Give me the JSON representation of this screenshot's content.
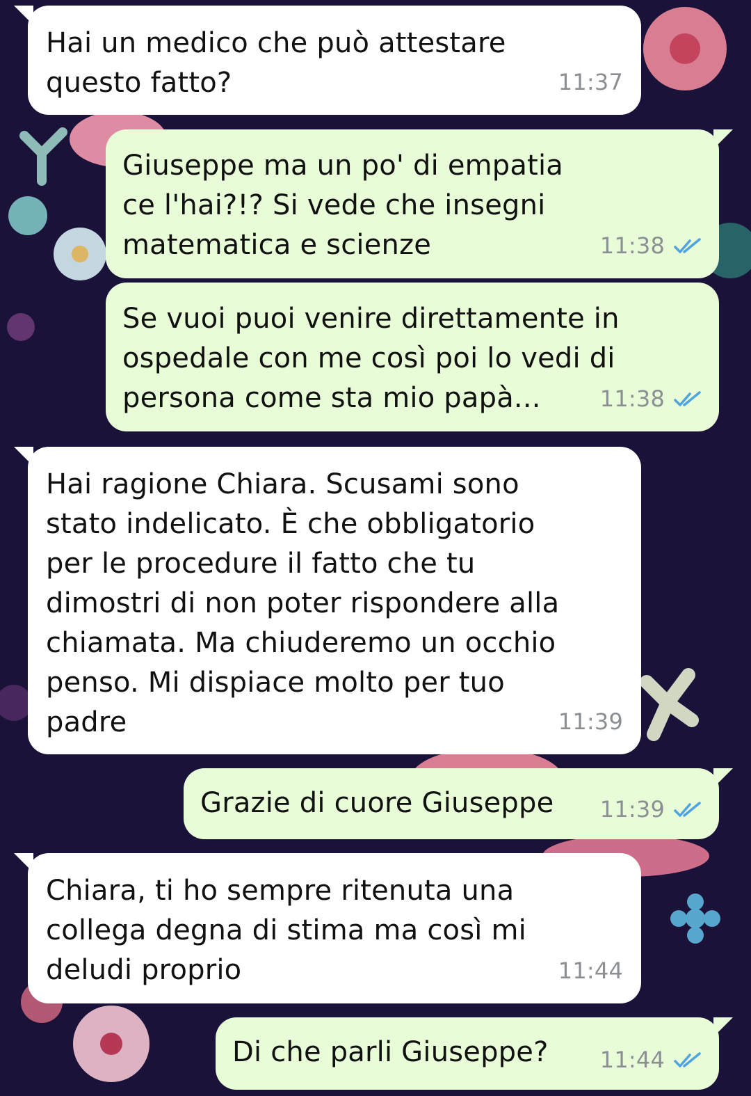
{
  "messages": [
    {
      "direction": "in",
      "text": "Hai un medico che può attestare\nquesto fatto?",
      "time": "11:37"
    },
    {
      "direction": "out",
      "text": "Giuseppe ma un po' di empatia\nce l'hai?!? Si vede che insegni\nmatematica e scienze",
      "time": "11:38",
      "read": true
    },
    {
      "direction": "out",
      "text": "Se vuoi puoi venire direttamente in\nospedale con me così poi lo vedi di\npersona come sta mio papà...",
      "time": "11:38",
      "read": true
    },
    {
      "direction": "in",
      "text": "Hai ragione Chiara. Scusami sono\nstato indelicato. È che obbligatorio\nper le procedure il fatto che tu\ndimostri di non poter rispondere alla\nchiamata. Ma chiuderemo un occhio\npenso. Mi dispiace molto per tuo\npadre",
      "time": "11:39"
    },
    {
      "direction": "out",
      "text": "Grazie di cuore Giuseppe",
      "time": "11:39",
      "read": true
    },
    {
      "direction": "in",
      "text": "Chiara, ti ho sempre ritenuta una\ncollega degna di stima ma così mi\ndeludi proprio",
      "time": "11:44"
    },
    {
      "direction": "out",
      "text": "Di che parli Giuseppe?",
      "time": "11:44",
      "read": true
    }
  ],
  "icons": {
    "read_receipt": "double-check-icon"
  },
  "colors": {
    "incoming_bubble": "#ffffff",
    "outgoing_bubble": "#e8fcd7",
    "read_ticks": "#4fa3e0",
    "wallpaper": "#1a1238"
  }
}
